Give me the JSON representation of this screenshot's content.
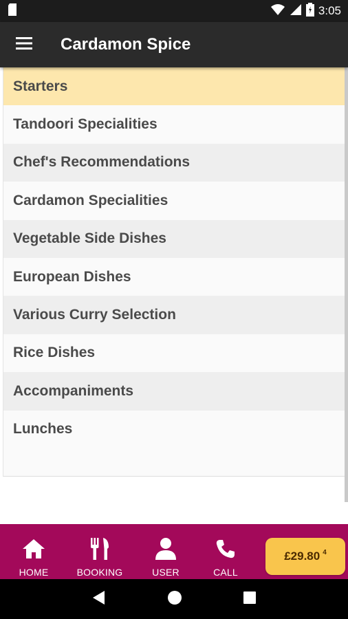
{
  "status_bar": {
    "time": "3:05"
  },
  "app_bar": {
    "title": "Cardamon Spice"
  },
  "categories": [
    {
      "label": "Starters",
      "active": true
    },
    {
      "label": "Tandoori Specialities",
      "active": false
    },
    {
      "label": "Chef's Recommendations",
      "active": false
    },
    {
      "label": "Cardamon Specialities",
      "active": false
    },
    {
      "label": "Vegetable Side Dishes",
      "active": false
    },
    {
      "label": "European Dishes",
      "active": false
    },
    {
      "label": "Various Curry Selection",
      "active": false
    },
    {
      "label": "Rice Dishes",
      "active": false
    },
    {
      "label": "Accompaniments",
      "active": false
    },
    {
      "label": "Lunches",
      "active": false
    }
  ],
  "bottom_nav": {
    "home": {
      "label": "HOME",
      "icon": "home-icon"
    },
    "booking": {
      "label": "BOOKING",
      "icon": "fork-knife-icon"
    },
    "user": {
      "label": "USER",
      "icon": "user-icon"
    },
    "call": {
      "label": "CALL",
      "icon": "phone-icon"
    }
  },
  "cart": {
    "total": "£29.80",
    "count": "4"
  },
  "colors": {
    "brand": "#a3095a",
    "active_item": "#fde7ad",
    "cart_button": "#f9c54c",
    "app_bar": "#2b2b2b"
  }
}
